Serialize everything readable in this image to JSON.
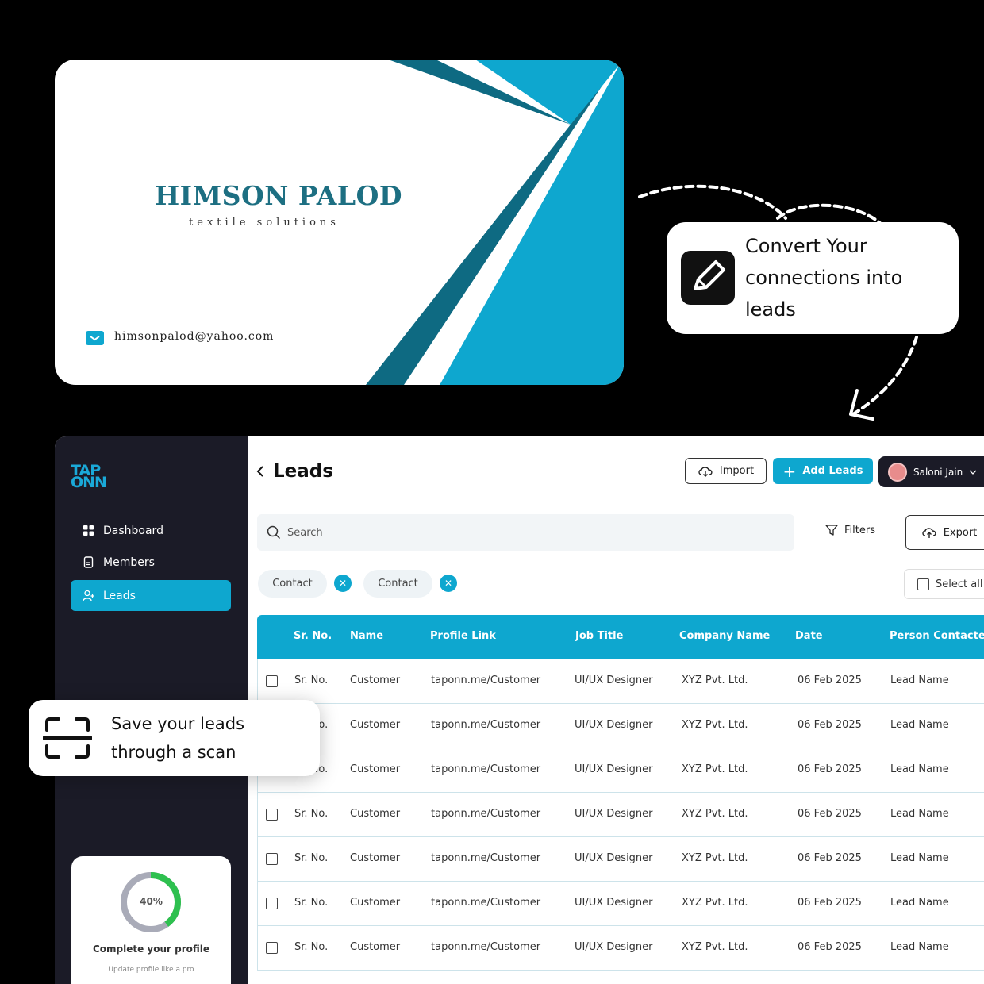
{
  "business_card": {
    "company": "HIMSON PALOD",
    "tagline": "textile solutions",
    "email": "himsonpalod@yahoo.com",
    "accent_color": "#0ea7cf",
    "dark_accent_color": "#0e6a82"
  },
  "callouts": {
    "convert": "Convert Your connections into leads",
    "scan": "Save your leads through a scan"
  },
  "app": {
    "logo_line1": "TAP",
    "logo_line2": "ONN",
    "sidebar": {
      "items": [
        {
          "label": "Dashboard",
          "icon": "grid-icon"
        },
        {
          "label": "Members",
          "icon": "document-icon"
        },
        {
          "label": "Leads",
          "icon": "user-plus-icon",
          "active": true
        }
      ]
    },
    "profile": {
      "progress_label": "40%",
      "progress": 0.4,
      "title": "Complete your profile",
      "subtitle": "Update profile like a pro"
    },
    "header": {
      "title": "Leads",
      "import_label": "Import",
      "add_label": "Add Leads",
      "user_name": "Saloni Jain"
    },
    "search": {
      "placeholder": "Search"
    },
    "filters_label": "Filters",
    "export_label": "Export",
    "chips": [
      "Contact",
      "Contact"
    ],
    "select_all_label": "Select all",
    "table": {
      "columns": [
        "Sr. No.",
        "Name",
        "Profile Link",
        "Job Title",
        "Company Name",
        "Date",
        "Person Contacted"
      ],
      "rows": [
        [
          "Sr. No.",
          "Customer",
          "taponn.me/Customer",
          "UI/UX Designer",
          "XYZ Pvt. Ltd.",
          "06 Feb 2025",
          "Lead Name"
        ],
        [
          "Sr. No.",
          "Customer",
          "taponn.me/Customer",
          "UI/UX Designer",
          "XYZ Pvt. Ltd.",
          "06 Feb 2025",
          "Lead Name"
        ],
        [
          "Sr. No.",
          "Customer",
          "taponn.me/Customer",
          "UI/UX Designer",
          "XYZ Pvt. Ltd.",
          "06 Feb 2025",
          "Lead Name"
        ],
        [
          "Sr. No.",
          "Customer",
          "taponn.me/Customer",
          "UI/UX Designer",
          "XYZ Pvt. Ltd.",
          "06 Feb 2025",
          "Lead Name"
        ],
        [
          "Sr. No.",
          "Customer",
          "taponn.me/Customer",
          "UI/UX Designer",
          "XYZ Pvt. Ltd.",
          "06 Feb 2025",
          "Lead Name"
        ],
        [
          "Sr. No.",
          "Customer",
          "taponn.me/Customer",
          "UI/UX Designer",
          "XYZ Pvt. Ltd.",
          "06 Feb 2025",
          "Lead Name"
        ],
        [
          "Sr. No.",
          "Customer",
          "taponn.me/Customer",
          "UI/UX Designer",
          "XYZ Pvt. Ltd.",
          "06 Feb 2025",
          "Lead Name"
        ]
      ]
    }
  }
}
